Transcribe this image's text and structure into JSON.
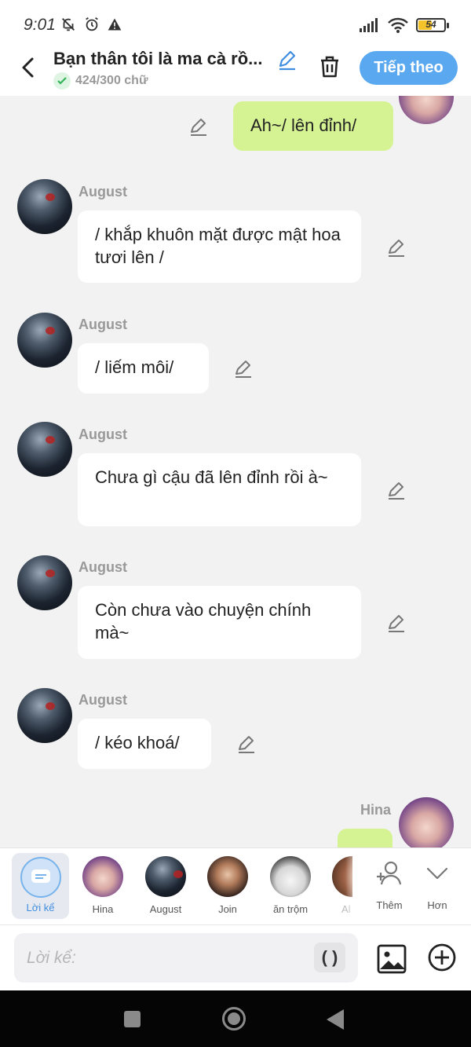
{
  "status_bar": {
    "time": "9:01",
    "battery": "54",
    "battery_level": 0.54
  },
  "header": {
    "title": "Bạn thân tôi là ma cà rồ...",
    "word_count": "424/300 chữ",
    "next_label": "Tiếp theo"
  },
  "messages": [
    {
      "sender": "",
      "text": "Ah~/ lên đỉnh/",
      "side": "right"
    },
    {
      "sender": "August",
      "text": "/ khắp khuôn mặt được mật hoa tươi lên /",
      "side": "left"
    },
    {
      "sender": "August",
      "text": "/ liếm môi/",
      "side": "left"
    },
    {
      "sender": "August",
      "text": "Chưa gì cậu đã lên đỉnh rồi à~",
      "side": "left"
    },
    {
      "sender": "August",
      "text": "Còn chưa vào chuyện chính mà~",
      "side": "left"
    },
    {
      "sender": "August",
      "text": "/ kéo khoá/",
      "side": "left"
    },
    {
      "sender": "Hina",
      "text": "",
      "side": "right"
    }
  ],
  "characters": {
    "narrator_label": "Lời kể",
    "items": [
      {
        "name": "Hina"
      },
      {
        "name": "August"
      },
      {
        "name": "Join"
      },
      {
        "name": "ăn trộm"
      },
      {
        "name": "Al"
      }
    ],
    "more_label": "Thêm",
    "collapse_label": "Hơn"
  },
  "input": {
    "placeholder": "Lời kể:",
    "paren_label": "( )"
  },
  "colors": {
    "accent": "#59a8f0",
    "user_bubble": "#d6f394",
    "background": "#f2f2f2"
  },
  "icons": [
    "back-arrow-icon",
    "pencil-icon",
    "trash-icon",
    "check-icon",
    "person-add-icon",
    "chevron-down-icon",
    "image-icon",
    "plus-circle-icon",
    "chat-bubble-icon"
  ]
}
